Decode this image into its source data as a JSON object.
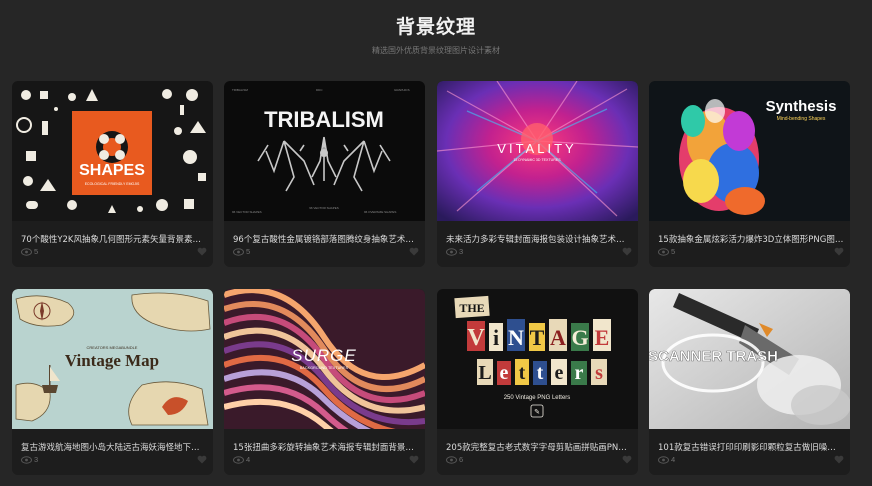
{
  "header": {
    "title": "背景纹理",
    "subtitle": "精选国外优质背景纹理图片设计素材"
  },
  "cards": [
    {
      "title": "70个酸性Y2K风抽象几何图形元素矢量背景素材 Vi...",
      "views": "5",
      "thumb_text": "SHAPES",
      "thumb_subtext": "ECOLOGICAL FRIENDLY EMOJIS"
    },
    {
      "title": "96个复古酸性金属镀铬部落图腾纹身抽象艺术图形...",
      "views": "5",
      "thumb_text": "TRIBALISM",
      "thumb_subtext": "96 VECTOR SHAPES"
    },
    {
      "title": "未来活力多彩专辑封面海报包装设计抽象艺术爆炸...",
      "views": "3",
      "thumb_text": "VITALITY",
      "thumb_subtext": "15 DYNAMIC 3D TEXTURES"
    },
    {
      "title": "15款抽象金属炫彩活力爆炸3D立体图形PNG图片...",
      "views": "5",
      "thumb_text": "Synthesis",
      "thumb_subtext": "Mind-bending Shapes"
    },
    {
      "title": "复古游戏航海地图小岛大陆远古海妖海怪地下城冒...",
      "views": "3",
      "thumb_text": "Vintage Map",
      "thumb_subtext": "CREATORS MEGABUNDLE"
    },
    {
      "title": "15张扭曲多彩旋转抽象艺术海报专辑封面背景设计...",
      "views": "4",
      "thumb_text": "SURGE",
      "thumb_subtext": "BACKGROUND TEXTURES"
    },
    {
      "title": "205款完整复古老式数字字母剪贴画拼贴画PNG免...",
      "views": "6",
      "thumb_text": "Vintage Letters",
      "thumb_subtext": "250 Vintage PNG Letters"
    },
    {
      "title": "101款复古错误打印印刷影印颗粒复古做旧噪点阻...",
      "views": "4",
      "thumb_text": "SCANNER TRASH",
      "thumb_subtext": ""
    }
  ],
  "colors": {
    "background": "#262626",
    "card_background": "#1d1d1d",
    "title_text": "#f2f2f2",
    "muted_text": "#6e6e6e"
  },
  "icons": {
    "views": "eye-icon",
    "like": "heart-icon"
  }
}
